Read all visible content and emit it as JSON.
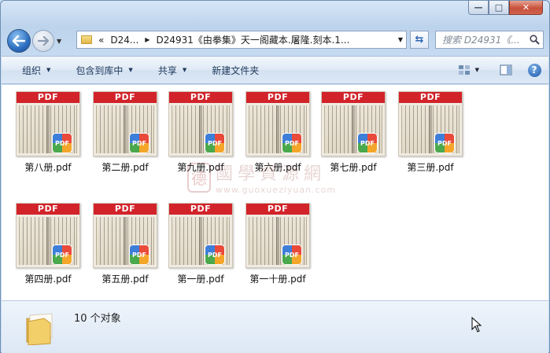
{
  "window": {
    "caption": {
      "minimize": "—",
      "maximize": "□",
      "close": "✕"
    }
  },
  "nav": {
    "back_icon": "back-arrow-icon",
    "forward_icon": "forward-arrow-icon"
  },
  "address": {
    "overflow": "«",
    "crumbs": [
      "D24...",
      "D24931《由拳集》天一阁藏本.屠隆.刻本.1..."
    ]
  },
  "search": {
    "placeholder": "搜索 D24931《..."
  },
  "toolbar": {
    "organize": "组织",
    "include_library": "包含到库中",
    "share": "共享",
    "new_folder": "新建文件夹"
  },
  "files": [
    {
      "name": "第八册.pdf",
      "banner": "PDF"
    },
    {
      "name": "第二册.pdf",
      "banner": "PDF"
    },
    {
      "name": "第九册.pdf",
      "banner": "PDF"
    },
    {
      "name": "第六册.pdf",
      "banner": "PDF"
    },
    {
      "name": "第七册.pdf",
      "banner": "PDF"
    },
    {
      "name": "第三册.pdf",
      "banner": "PDF"
    },
    {
      "name": "第四册.pdf",
      "banner": "PDF"
    },
    {
      "name": "第五册.pdf",
      "banner": "PDF"
    },
    {
      "name": "第一册.pdf",
      "banner": "PDF"
    },
    {
      "name": "第一十册.pdf",
      "banner": "PDF"
    }
  ],
  "watermark": {
    "seal": "德",
    "title": "國學資源網",
    "url": "www.guoxueziyuan.com"
  },
  "status": {
    "count": "10 个对象"
  },
  "colors": {
    "pdf_banner": "#d2232a",
    "accent": "#2d6fc1"
  }
}
